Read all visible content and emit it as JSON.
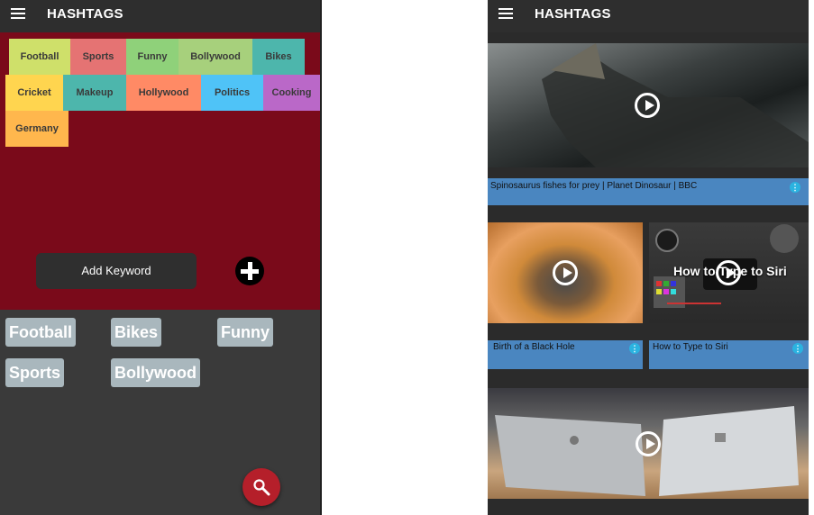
{
  "left": {
    "title": "HASHTAGS",
    "tags": [
      {
        "label": "Football",
        "color": "#cfe06a"
      },
      {
        "label": "Sports",
        "color": "#e57373"
      },
      {
        "label": "Funny",
        "color": "#8fd17a"
      },
      {
        "label": "Bollywood",
        "color": "#a7d07c"
      },
      {
        "label": "Bikes",
        "color": "#4db6ac"
      },
      {
        "label": "Cricket",
        "color": "#ffd54f"
      },
      {
        "label": "Makeup",
        "color": "#4db6ac"
      },
      {
        "label": "Hollywood",
        "color": "#ff8a65"
      },
      {
        "label": "Politics",
        "color": "#4fc3f7"
      },
      {
        "label": "Cooking",
        "color": "#ba68c8"
      },
      {
        "label": "Germany",
        "color": "#ffb74d"
      }
    ],
    "add_keyword_label": "Add Keyword",
    "plus_icon": "plus-icon",
    "chips": [
      "Football",
      "Bikes",
      "Funny",
      "Sports",
      "Bollywood"
    ],
    "fab_icon": "search-icon",
    "colors": {
      "tag_area": "#7a0a1a",
      "background": "#3a3a3a",
      "fab": "#b51f2a",
      "chip": "#a9b7bd"
    }
  },
  "right": {
    "title": "HASHTAGS",
    "videos": [
      {
        "caption": "Spinosaurus fishes for prey | Planet Dinosaur | BBC",
        "overlay": ""
      },
      {
        "caption": "Birth of a Black Hole",
        "overlay": ""
      },
      {
        "caption": "How to Type to Siri",
        "overlay": "How to Type to Siri"
      },
      {
        "caption": "",
        "overlay": ""
      }
    ],
    "colors": {
      "caption_bar": "#4a86c0",
      "info": "#2bb3e0"
    }
  }
}
